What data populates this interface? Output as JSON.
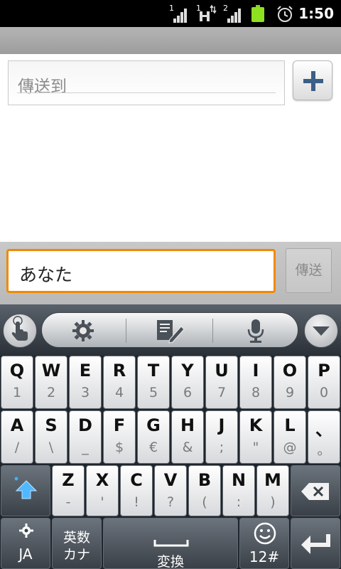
{
  "status_bar": {
    "time": "1:50",
    "signal_labels": [
      "1",
      "1",
      "2"
    ],
    "icons": [
      "signal-icon",
      "data-transfer-icon",
      "signal-icon",
      "battery-icon",
      "alarm-icon"
    ],
    "battery_color": "#8ee021"
  },
  "recipient": {
    "placeholder": "傳送到",
    "add_icon": "plus-icon"
  },
  "compose": {
    "value": "あなた",
    "send_label": "傳送",
    "focus_color": "#f08a00"
  },
  "keyboard": {
    "toolbar": {
      "icons": [
        "hand-touch-icon",
        "gear-icon",
        "edit-notes-icon",
        "microphone-icon",
        "chevron-down-icon"
      ]
    },
    "rows": [
      [
        {
          "main": "Q",
          "sub": "1"
        },
        {
          "main": "W",
          "sub": "2"
        },
        {
          "main": "E",
          "sub": "3"
        },
        {
          "main": "R",
          "sub": "4"
        },
        {
          "main": "T",
          "sub": "5"
        },
        {
          "main": "Y",
          "sub": "6"
        },
        {
          "main": "U",
          "sub": "7"
        },
        {
          "main": "I",
          "sub": "8"
        },
        {
          "main": "O",
          "sub": "9"
        },
        {
          "main": "P",
          "sub": "0"
        }
      ],
      [
        {
          "main": "A",
          "sub": "/"
        },
        {
          "main": "S",
          "sub": "\\"
        },
        {
          "main": "D",
          "sub": "_"
        },
        {
          "main": "F",
          "sub": "$"
        },
        {
          "main": "G",
          "sub": "€"
        },
        {
          "main": "H",
          "sub": "&"
        },
        {
          "main": "J",
          "sub": ";"
        },
        {
          "main": "K",
          "sub": "\""
        },
        {
          "main": "L",
          "sub": "@"
        },
        {
          "main": "、",
          "sub": "。"
        }
      ],
      [
        {
          "main": "Z",
          "sub": "-"
        },
        {
          "main": "X",
          "sub": "'"
        },
        {
          "main": "C",
          "sub": "!"
        },
        {
          "main": "V",
          "sub": "?"
        },
        {
          "main": "B",
          "sub": "("
        },
        {
          "main": "N",
          "sub": ":"
        },
        {
          "main": "M",
          "sub": ")"
        }
      ]
    ],
    "bottom": {
      "lang_label": "JA",
      "mode_line1": "英数",
      "mode_line2": "カナ",
      "space_label": "変換",
      "num_label": "12#"
    }
  }
}
